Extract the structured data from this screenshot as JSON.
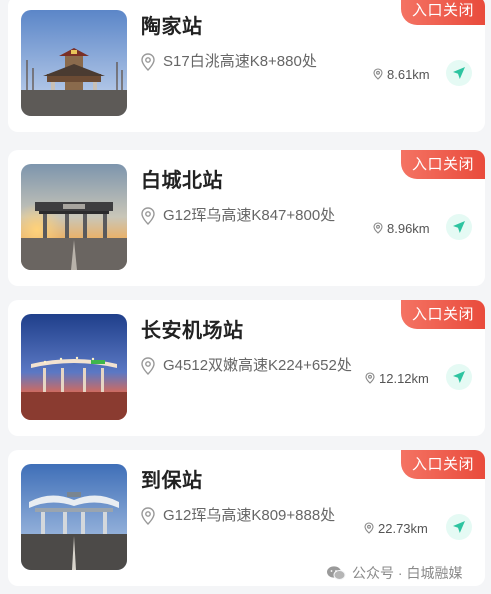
{
  "stations": [
    {
      "name": "陶家站",
      "status": "入口关闭",
      "address": "S17白洮高速K8+880处",
      "distance": "8.61km",
      "photo": "toll-gate-tower-photo"
    },
    {
      "name": "白城北站",
      "status": "入口关闭",
      "address": "G12珲乌高速K847+800处",
      "distance": "8.96km",
      "photo": "toll-gate-sunset-photo"
    },
    {
      "name": "长安机场站",
      "status": "入口关闭",
      "address": "G4512双嫩高速K224+652处",
      "distance": "12.12km",
      "photo": "toll-gate-lit-canopy-photo"
    },
    {
      "name": "到保站",
      "status": "入口关闭",
      "address": "G12珲乌高速K809+888处",
      "distance": "22.73km",
      "photo": "toll-gate-wave-roof-photo"
    }
  ],
  "icons": {
    "address": "location-pin-icon",
    "distance": "small-location-pin-icon",
    "navigate": "navigation-arrow-icon",
    "watermark": "wechat-icon"
  },
  "colors": {
    "badge": "#ec5a49",
    "navigate_bg": "#e5faf4",
    "navigate_arrow": "#2ec4a0"
  },
  "watermark": {
    "text": "公众号 · 白城融媒"
  }
}
